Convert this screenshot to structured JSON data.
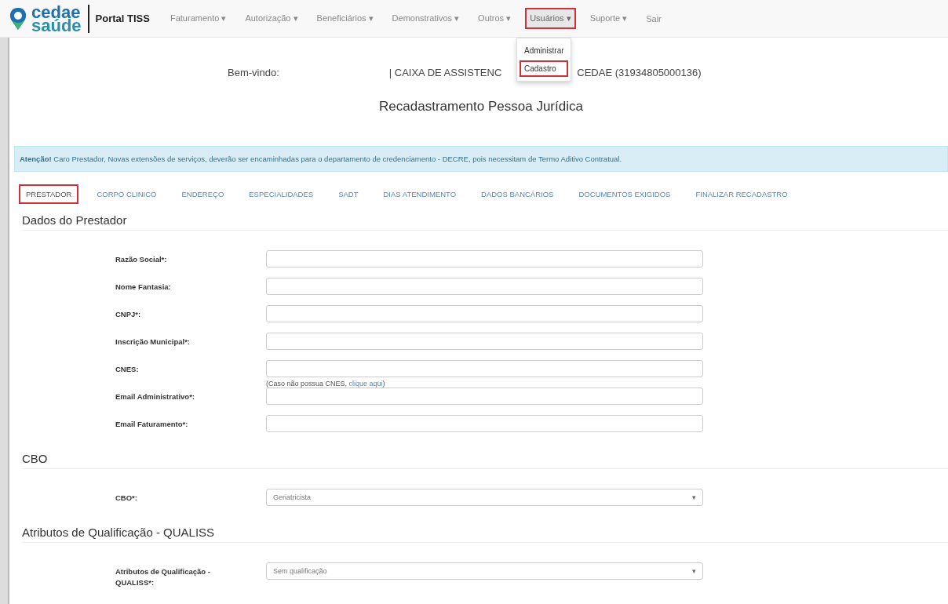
{
  "brand": {
    "line1": "cedae",
    "line2": "saúde",
    "portal": "Portal TISS"
  },
  "nav": [
    {
      "label": "Faturamento",
      "highlighted": false
    },
    {
      "label": "Autorização",
      "highlighted": false
    },
    {
      "label": "Beneficiários",
      "highlighted": false
    },
    {
      "label": "Demonstrativos",
      "highlighted": false
    },
    {
      "label": "Outros",
      "highlighted": false
    },
    {
      "label": "Usuários",
      "highlighted": true,
      "menu": [
        {
          "label": "Administrar",
          "highlighted": false
        },
        {
          "label": "Cadastro",
          "highlighted": true
        }
      ]
    },
    {
      "label": "Suporte",
      "highlighted": false
    },
    {
      "label": "Sair",
      "highlighted": false,
      "plain": true
    }
  ],
  "caret": "▾",
  "welcome": {
    "label": "Bem-vindo:",
    "org_start": "| CAIXA DE ASSISTENC",
    "org_end": "CEDAE (31934805000136)"
  },
  "title": "Recadastramento Pessoa Jurídica",
  "alert": {
    "text": "**Atenção!** Caro Prestador, Novas extensões de serviços, deverão ser encaminhadas para o departamento de credenciamento - DECRE, pois necessitam de Termo Aditivo Contratual."
  },
  "tabs": [
    {
      "label": "PRESTADOR",
      "selected": true
    },
    {
      "label": "CORPO CLINICO",
      "selected": false
    },
    {
      "label": "ENDEREÇO",
      "selected": false
    },
    {
      "label": "ESPECIALIDADES",
      "selected": false
    },
    {
      "label": "SADT",
      "selected": false
    },
    {
      "label": "DIAS ATENDIMENTO",
      "selected": false
    },
    {
      "label": "DADOS BANCÁRIOS",
      "selected": false
    },
    {
      "label": "DOCUMENTOS EXIGIDOS",
      "selected": false
    },
    {
      "label": "FINALIZAR RECADASTRO",
      "selected": false
    }
  ],
  "sections": [
    {
      "title": "Dados do Prestador",
      "fields": [
        {
          "kind": "text",
          "label": "Razão Social*:"
        },
        {
          "kind": "text",
          "label": "Nome Fantasia:"
        },
        {
          "kind": "text",
          "label": "CNPJ*:"
        },
        {
          "kind": "text",
          "label": "Inscrição Municipal*:"
        },
        {
          "kind": "text",
          "label": "CNES:",
          "help": "(Caso não possua CNES, ",
          "help_link": "clique aqui",
          "help_end": ")"
        },
        {
          "kind": "text",
          "label": "Email Administrativo*:"
        },
        {
          "kind": "text",
          "label": "Email Faturamento*:"
        }
      ]
    },
    {
      "title": "CBO",
      "fields": [
        {
          "kind": "select",
          "label": "CBO*:",
          "value": "Geriatricista"
        }
      ]
    },
    {
      "title": "Atributos de Qualificação - QUALISS",
      "fields": [
        {
          "kind": "select",
          "label": "Atributos de Qualificação - QUALISS*:",
          "value": "Sem qualificação"
        }
      ]
    }
  ]
}
